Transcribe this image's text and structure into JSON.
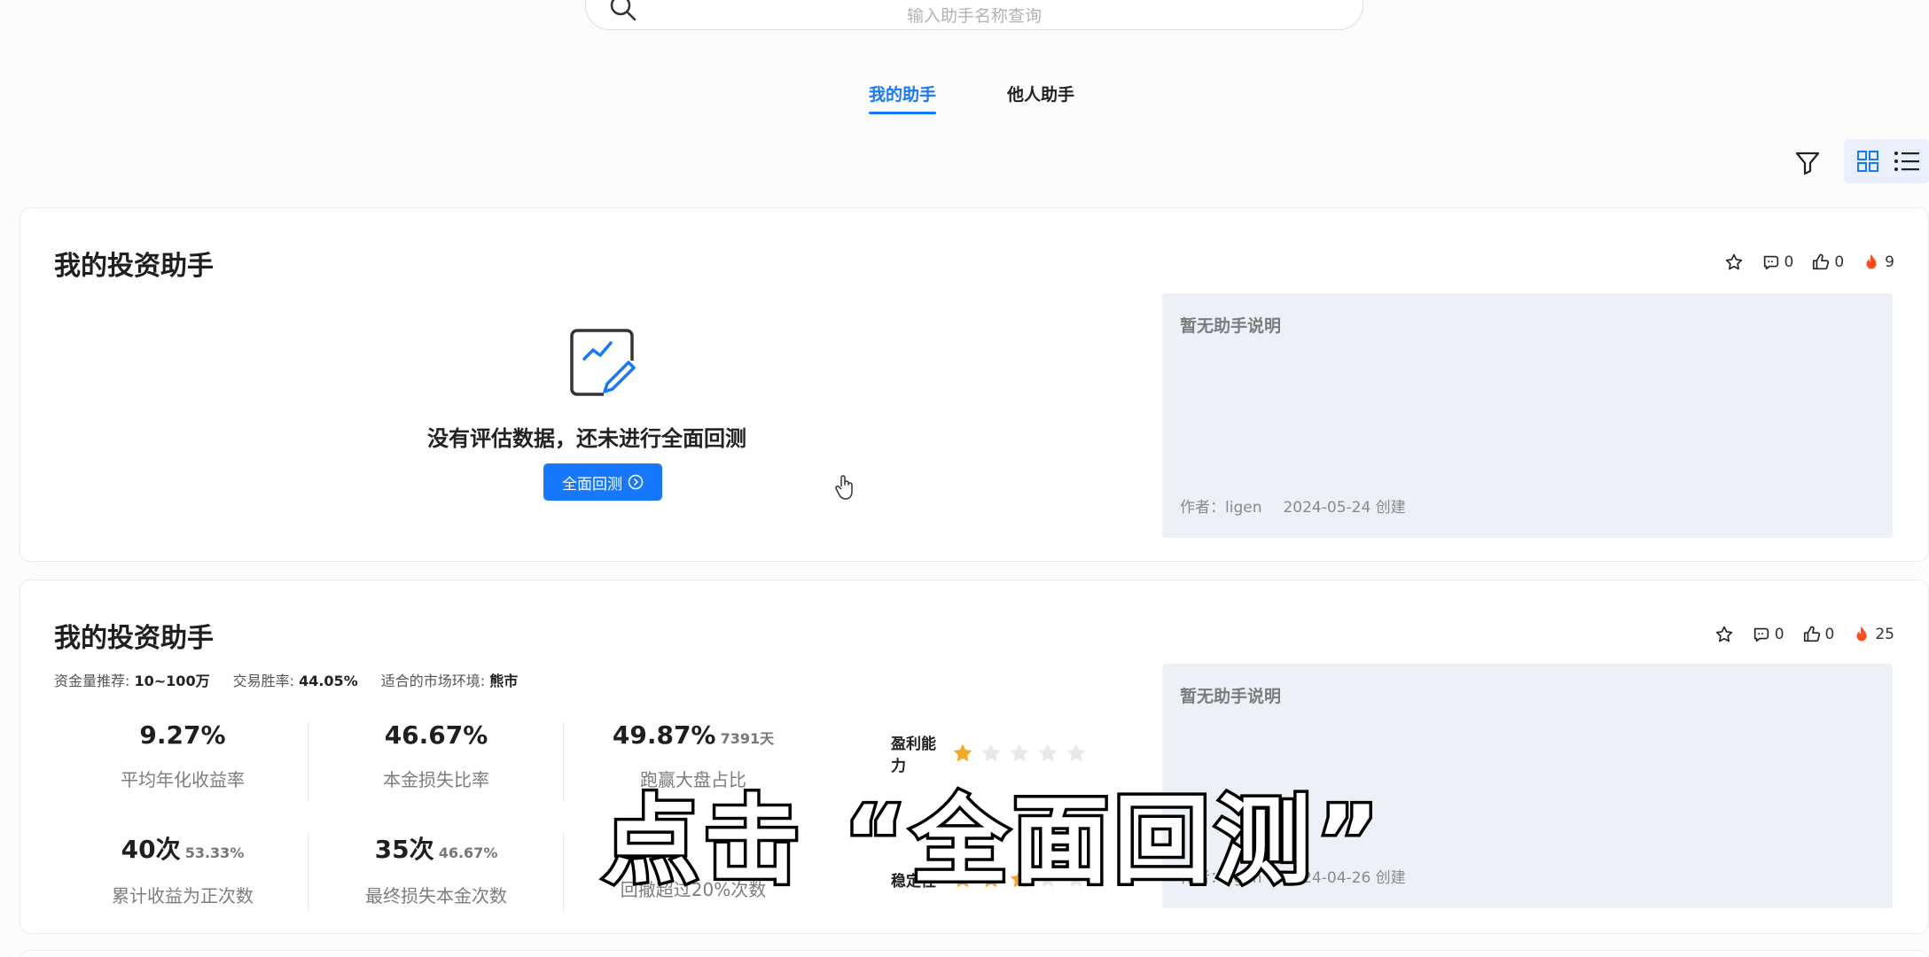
{
  "search": {
    "placeholder": "输入助手名称查询"
  },
  "tabs": [
    {
      "label": "我的助手",
      "active": true
    },
    {
      "label": "他人助手",
      "active": false
    }
  ],
  "toolbar": {
    "filter_icon": "filter-icon",
    "view_modes": [
      "grid",
      "list"
    ],
    "active_view": "grid"
  },
  "colors": {
    "accent": "#1677ff",
    "star_filled": "#f5a623",
    "star_empty": "#e8e8e8",
    "fire": "#ff4d1a"
  },
  "cards": [
    {
      "title": "我的投资助手",
      "stats": {
        "comments": "0",
        "likes": "0",
        "hot": "9"
      },
      "empty_text": "没有评估数据，还未进行全面回测",
      "backtest_button": "全面回测",
      "desc_title": "暂无助手说明",
      "author": "作者：ligen",
      "created": "2024-05-24 创建"
    },
    {
      "title": "我的投资助手",
      "stats": {
        "comments": "0",
        "likes": "0",
        "hot": "25"
      },
      "tags": [
        {
          "label": "资金量推荐:",
          "value": "10~100万"
        },
        {
          "label": "交易胜率:",
          "value": "44.05%"
        },
        {
          "label": "适合的市场环境:",
          "value": "熊市"
        }
      ],
      "metrics": [
        {
          "value": "9.27%",
          "sub": "",
          "label": "平均年化收益率"
        },
        {
          "value": "46.67%",
          "sub": "",
          "label": "本金损失比率"
        },
        {
          "value": "49.87%",
          "sub": "7391天",
          "label": "跑赢大盘占比"
        },
        {
          "value": "40次",
          "sub": "53.33%",
          "label": "累计收益为正次数"
        },
        {
          "value": "35次",
          "sub": "46.67%",
          "label": "最终损失本金次数"
        },
        {
          "value": "",
          "sub": "",
          "label": "回撤超过20%次数"
        }
      ],
      "ratings": [
        {
          "label": "盈利能力",
          "stars": 1
        },
        {
          "label": "稳定性",
          "stars": 3
        }
      ],
      "desc_title": "暂无助手说明",
      "author": "作者：ligen",
      "created": "2024-04-26 创建"
    }
  ],
  "overlay_caption": "点击 “全面回测”"
}
